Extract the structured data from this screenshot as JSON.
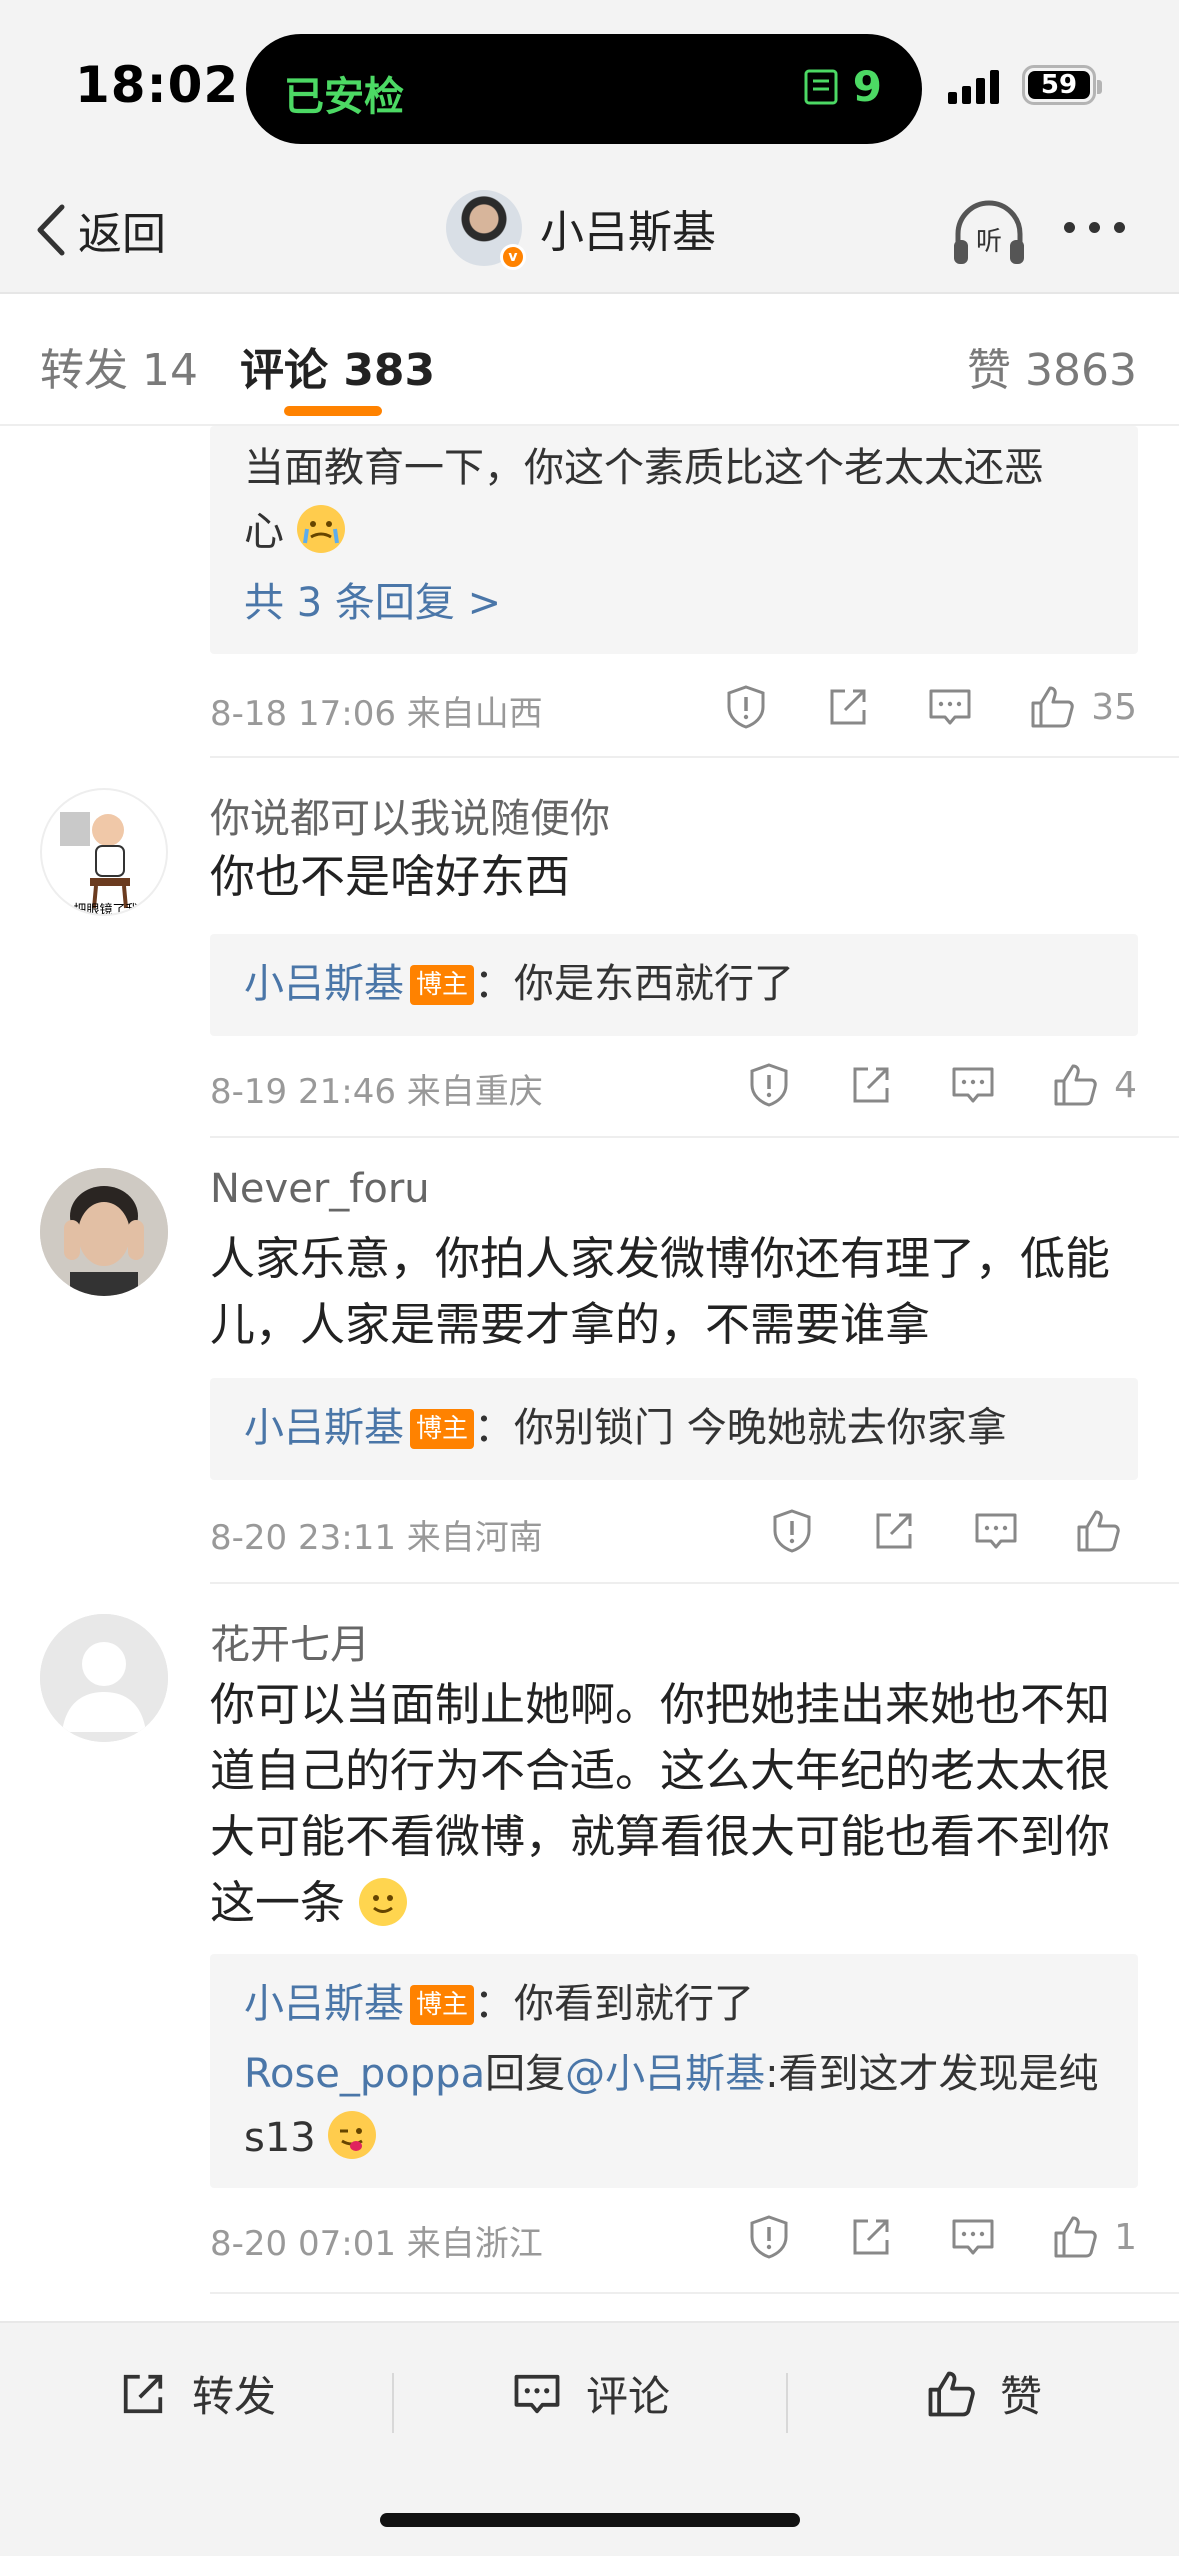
{
  "status_bar": {
    "time": "18:02",
    "island_left": "已安检",
    "island_right": "9",
    "battery": "59"
  },
  "nav": {
    "back_label": "返回",
    "title": "小吕斯基",
    "listen_label": "听"
  },
  "tabs": {
    "repost": "转发 14",
    "comment": "评论 383",
    "like": "赞 3863"
  },
  "comments": [
    {
      "partial_reply_line1": "当面教育一下，你这个素质比这个老太太还恶",
      "partial_reply_line2": "心",
      "more_replies": "共 3 条回复 >",
      "meta": "8-18 17:06 来自山西",
      "likes": "35"
    },
    {
      "user": "你说都可以我说随便你",
      "body": "你也不是啥好东西",
      "reply_author": "小吕斯基",
      "reply_tag": "博主",
      "reply_text": "：你是东西就行了",
      "meta": "8-19 21:46 来自重庆",
      "likes": "4",
      "avatar_text": "把眼镜了我"
    },
    {
      "user": "Never_foru",
      "body": "人家乐意，你拍人家发微博你还有理了，低能儿，人家是需要才拿的，不需要谁拿",
      "reply_author": "小吕斯基",
      "reply_tag": "博主",
      "reply_text": "：你别锁门 今晚她就去你家拿",
      "meta": "8-20 23:11 来自河南",
      "likes": ""
    },
    {
      "user": "花开七月",
      "body": "你可以当面制止她啊。你把她挂出来她也不知道自己的行为不合适。这么大年纪的老太太很大可能不看微博，就算看很大可能也看不到你这一条",
      "reply_author": "小吕斯基",
      "reply_tag": "博主",
      "reply_text": "：你看到就行了",
      "reply2_author": "Rose_poppa",
      "reply2_mid": "回复",
      "reply2_mention": "@小吕斯基",
      "reply2_text": ":看到这才发现是纯 s13",
      "meta": "8-20 07:01 来自浙江",
      "likes": "1"
    }
  ],
  "bottom_bar": {
    "repost": "转发",
    "comment": "评论",
    "like": "赞"
  },
  "colors": {
    "accent": "#ff8200",
    "link": "#4a76a8",
    "meta": "#999999"
  }
}
